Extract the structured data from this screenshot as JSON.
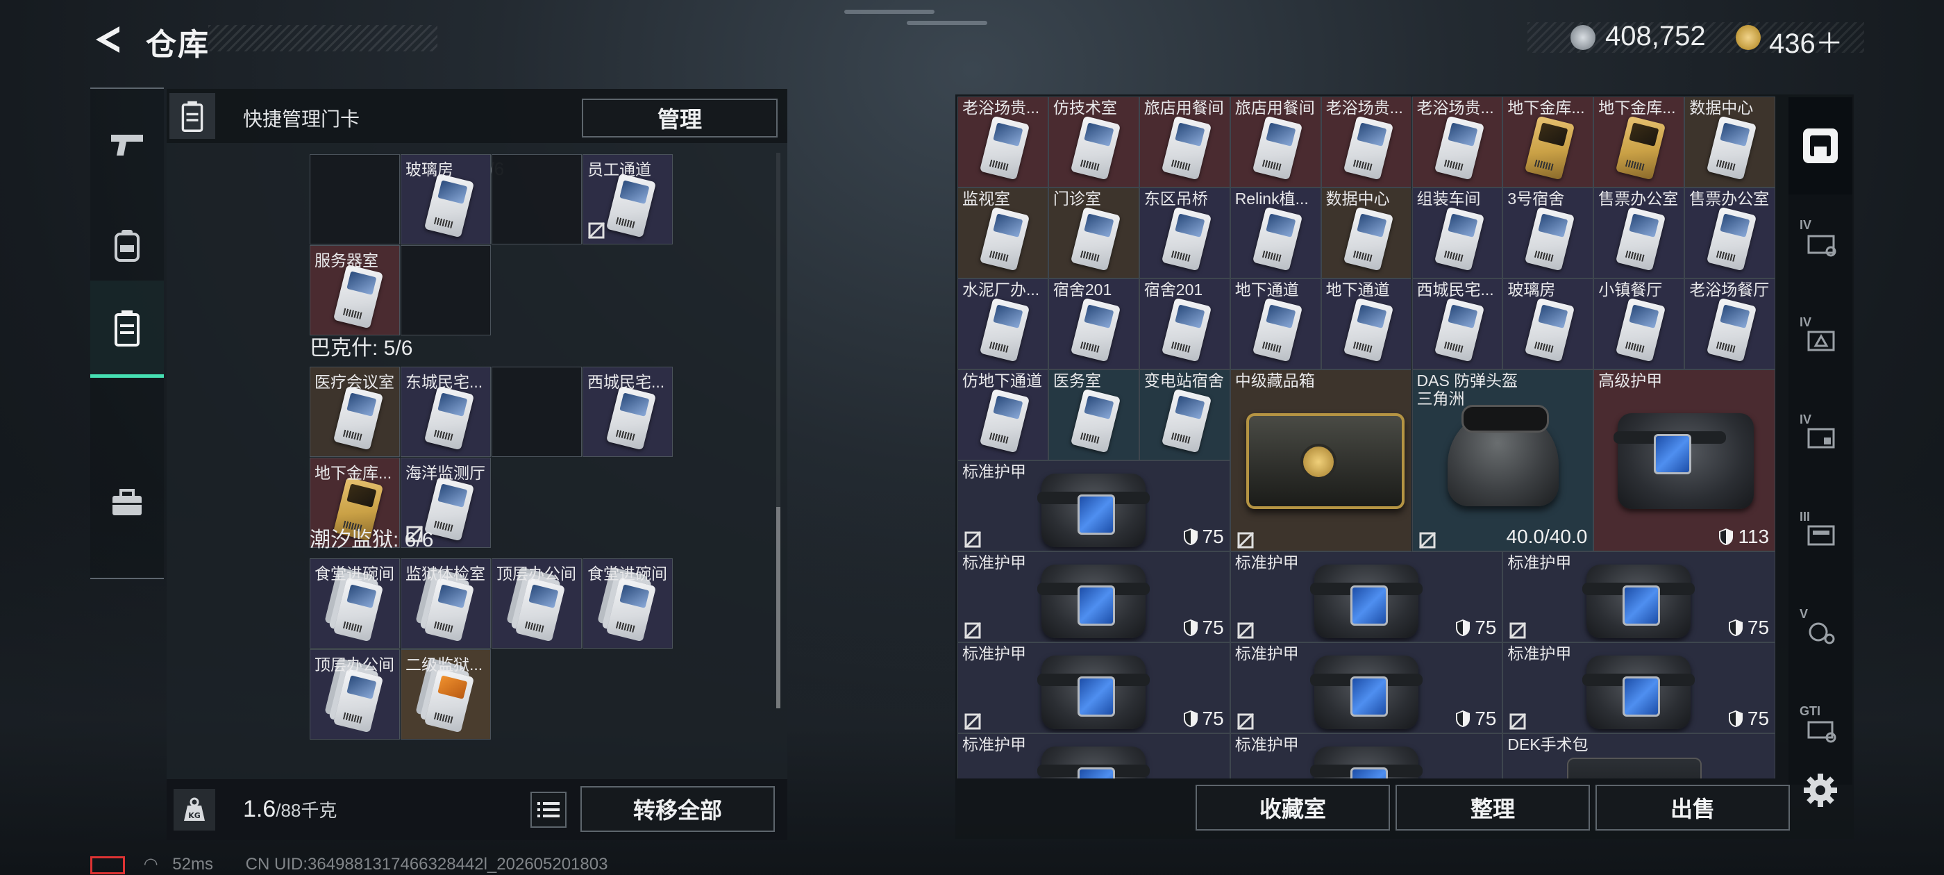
{
  "header": {
    "title": "仓库",
    "currency1": "408,752",
    "currency2": "436＋"
  },
  "left_rail": [
    "pistol-icon",
    "backpack-icon",
    "keycard-case-icon",
    "toolbox-icon"
  ],
  "left_panel": {
    "header_label": "快捷管理门卡",
    "manage_button": "管理",
    "ghost_text": "3/6",
    "sections": [
      {
        "title": "",
        "cells": [
          {
            "label": "",
            "type": "empty"
          },
          {
            "label": "玻璃房",
            "type": "purple",
            "card": "white"
          },
          {
            "label": "",
            "type": "empty"
          },
          {
            "label": "员工通道",
            "type": "purple",
            "card": "white",
            "nodrop": true
          },
          {
            "label": "服务器室",
            "type": "red",
            "card": "white"
          },
          {
            "label": "",
            "type": "empty"
          }
        ]
      },
      {
        "title": "巴克什: 5/6",
        "cells": [
          {
            "label": "医疗会议室",
            "type": "brown",
            "card": "white"
          },
          {
            "label": "东城民宅...",
            "type": "purple",
            "card": "white"
          },
          {
            "label": "",
            "type": "empty"
          },
          {
            "label": "西城民宅...",
            "type": "purple",
            "card": "white"
          },
          {
            "label": "地下金库...",
            "type": "red",
            "card": "gold"
          },
          {
            "label": "海洋监测厅",
            "type": "purple",
            "card": "white",
            "nodrop": true
          }
        ]
      },
      {
        "title": "潮汐监狱: 6/6",
        "cells": [
          {
            "label": "食堂进碗间",
            "type": "purple",
            "card": "stack"
          },
          {
            "label": "监狱体检室",
            "type": "purple",
            "card": "stack"
          },
          {
            "label": "顶层办公间",
            "type": "purple",
            "card": "stack"
          },
          {
            "label": "食堂进碗间",
            "type": "purple",
            "card": "stack"
          },
          {
            "label": "顶层办公间",
            "type": "purple",
            "card": "stack"
          },
          {
            "label": "二级监狱...",
            "type": "orange",
            "card": "orange"
          }
        ]
      }
    ],
    "weight": "1.6",
    "weight_unit": "/88千克",
    "transfer_button": "转移全部"
  },
  "right_panel": {
    "key_rows": [
      [
        {
          "label": "老浴场贵...",
          "bg": "red"
        },
        {
          "label": "仿技术室",
          "bg": "red"
        },
        {
          "label": "旅店用餐间",
          "bg": "red"
        },
        {
          "label": "旅店用餐间",
          "bg": "red"
        },
        {
          "label": "老浴场贵...",
          "bg": "red"
        },
        {
          "label": "老浴场贵...",
          "bg": "red"
        },
        {
          "label": "地下金库...",
          "bg": "red",
          "gold": true
        },
        {
          "label": "地下金库...",
          "bg": "red",
          "gold": true
        },
        {
          "label": "数据中心",
          "bg": "brown"
        }
      ],
      [
        {
          "label": "监视室",
          "bg": "brown"
        },
        {
          "label": "门诊室",
          "bg": "brown"
        },
        {
          "label": "东区吊桥",
          "bg": "purple"
        },
        {
          "label": "Relink植...",
          "bg": "purple"
        },
        {
          "label": "数据中心",
          "bg": "brown"
        },
        {
          "label": "组装车间",
          "bg": "purple"
        },
        {
          "label": "3号宿舍",
          "bg": "purple"
        },
        {
          "label": "售票办公室",
          "bg": "purple"
        },
        {
          "label": "售票办公室",
          "bg": "purple"
        }
      ],
      [
        {
          "label": "水泥厂办...",
          "bg": "purple"
        },
        {
          "label": "宿舍201",
          "bg": "purple"
        },
        {
          "label": "宿舍201",
          "bg": "purple"
        },
        {
          "label": "地下通道",
          "bg": "purple"
        },
        {
          "label": "地下通道",
          "bg": "purple"
        },
        {
          "label": "西城民宅...",
          "bg": "purple"
        },
        {
          "label": "玻璃房",
          "bg": "purple"
        },
        {
          "label": "小镇餐厅",
          "bg": "purple"
        },
        {
          "label": "老浴场餐厅",
          "bg": "purple"
        }
      ],
      [
        {
          "label": "仿地下通道",
          "bg": "purple"
        },
        {
          "label": "医务室",
          "bg": "teal"
        },
        {
          "label": "变电站宿舍",
          "bg": "teal"
        }
      ]
    ],
    "big_items": [
      {
        "name": "中级藏品箱",
        "value": ""
      },
      {
        "name": "DAS 防弹头盔",
        "sub": "三角洲",
        "value": "40.0/40.0"
      },
      {
        "name": "高级护甲",
        "value": "113"
      }
    ],
    "armor_label": "标准护甲",
    "armor_value": "75",
    "last_item": "DEK手术包",
    "buttons": [
      "收藏室",
      "整理",
      "出售"
    ]
  },
  "right_rail": [
    "vault-icon",
    "IV",
    "IV",
    "IV",
    "III",
    "V",
    "GTI"
  ],
  "status": {
    "ping": "52ms",
    "uid": "CN UID:3649881317466328442l_202605201803"
  }
}
